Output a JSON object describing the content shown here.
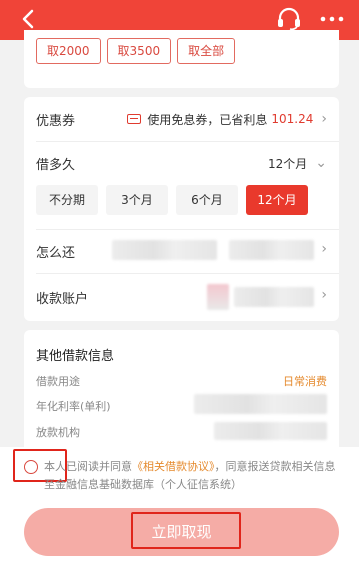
{
  "header": {
    "back_icon": "back-arrow-icon",
    "support_icon": "headset-icon",
    "menu_icon": "more-dots-icon",
    "bg": "#f04438"
  },
  "quick_amounts": [
    "取2000",
    "取3500",
    "取全部"
  ],
  "coupon": {
    "label": "优惠券",
    "text": "使用免息券，已省利息",
    "amount": "101.24"
  },
  "term": {
    "label": "借多久",
    "selected": "12个月",
    "options": [
      "不分期",
      "3个月",
      "6个月",
      "12个月"
    ]
  },
  "repay": {
    "label": "怎么还"
  },
  "account": {
    "label": "收款账户"
  },
  "other_info": {
    "title": "其他借款信息",
    "purpose_label": "借款用途",
    "purpose_value": "日常消费",
    "rate_label": "年化利率(单利)",
    "lender_label": "放款机构"
  },
  "agreement": {
    "prefix": "本人已阅读并同意",
    "link": "《相关借款协议》",
    "suffix": "，同意报送贷款相关信息至金融信息基础数据库（个人征信系统）"
  },
  "submit": {
    "label": "立即取现"
  }
}
